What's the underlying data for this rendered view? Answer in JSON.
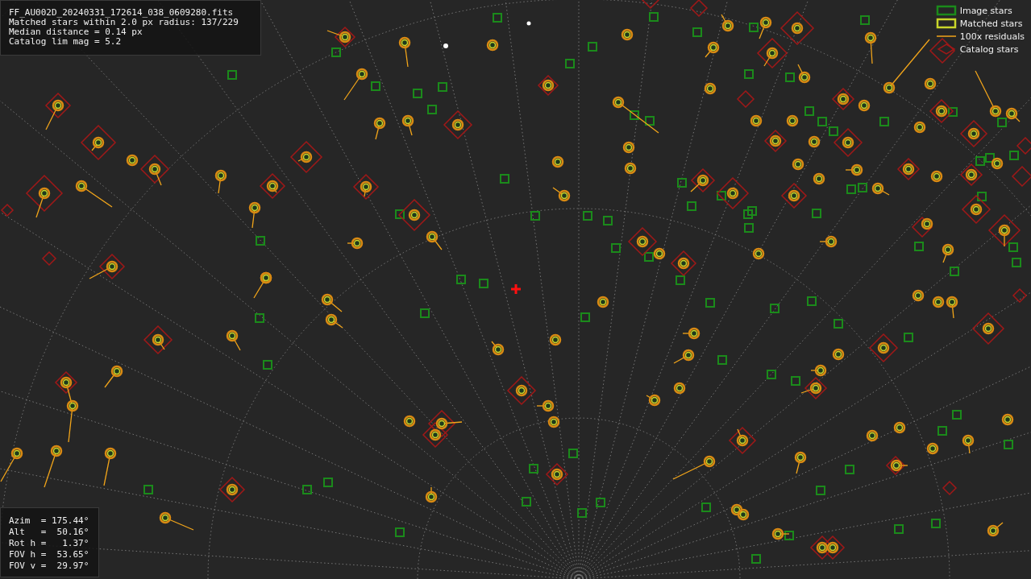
{
  "info_box": {
    "lines": [
      "FF_AU002D_20240331_172614_038_0609280.fits",
      "Matched stars within 2.0 px radius: 137/229",
      "Median distance = 0.14 px",
      "Catalog lim mag = 5.2"
    ]
  },
  "legend": [
    {
      "kind": "image",
      "label": "Image stars"
    },
    {
      "kind": "matched",
      "label": "Matched stars"
    },
    {
      "kind": "residual",
      "label": "100x residuals"
    },
    {
      "kind": "catalog",
      "label": "Catalog stars"
    }
  ],
  "pointing_box": {
    "lines": [
      "Azim  = 175.44°",
      "Alt   =  50.16°",
      "Rot h =   1.37°",
      "FOV h =  53.65°",
      "FOV v =  29.97°"
    ]
  }
}
